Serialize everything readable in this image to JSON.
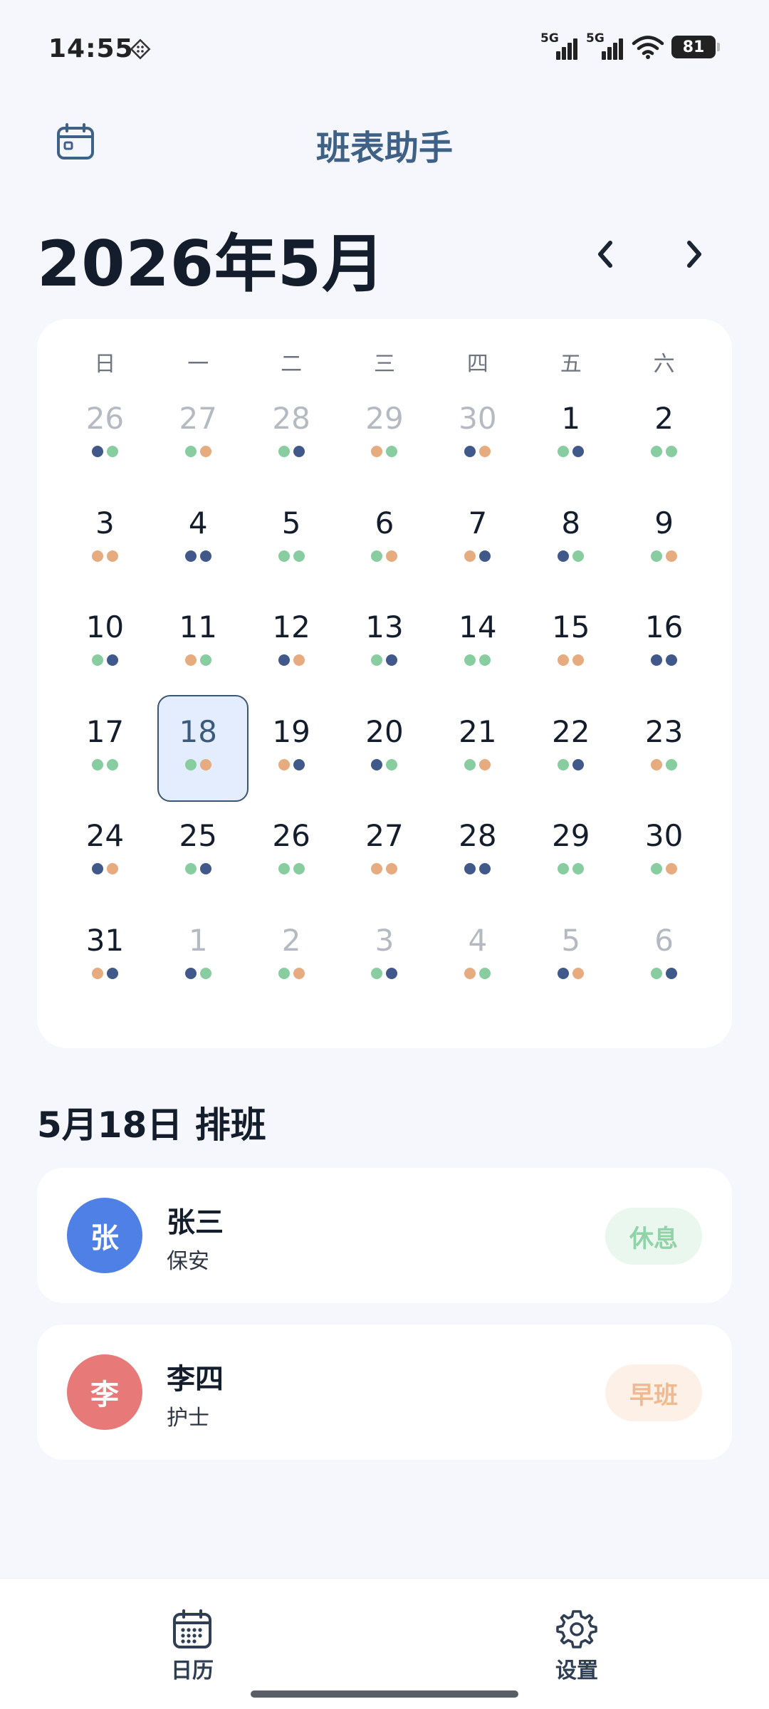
{
  "status_bar": {
    "time": "14:55",
    "network_1": "5G",
    "network_2": "5G",
    "battery": "81"
  },
  "header": {
    "title": "班表助手"
  },
  "calendar": {
    "month_title": "2026年5月",
    "weekdays": [
      "日",
      "一",
      "二",
      "三",
      "四",
      "五",
      "六"
    ],
    "selected_day": "18",
    "days": [
      {
        "n": "26",
        "other": true,
        "dots": [
          "blue",
          "green"
        ]
      },
      {
        "n": "27",
        "other": true,
        "dots": [
          "green",
          "orange"
        ]
      },
      {
        "n": "28",
        "other": true,
        "dots": [
          "green",
          "blue"
        ]
      },
      {
        "n": "29",
        "other": true,
        "dots": [
          "orange",
          "green"
        ]
      },
      {
        "n": "30",
        "other": true,
        "dots": [
          "blue",
          "orange"
        ]
      },
      {
        "n": "1",
        "other": false,
        "dots": [
          "green",
          "blue"
        ]
      },
      {
        "n": "2",
        "other": false,
        "dots": [
          "green",
          "green"
        ]
      },
      {
        "n": "3",
        "other": false,
        "dots": [
          "orange",
          "orange"
        ]
      },
      {
        "n": "4",
        "other": false,
        "dots": [
          "blue",
          "blue"
        ]
      },
      {
        "n": "5",
        "other": false,
        "dots": [
          "green",
          "green"
        ]
      },
      {
        "n": "6",
        "other": false,
        "dots": [
          "green",
          "orange"
        ]
      },
      {
        "n": "7",
        "other": false,
        "dots": [
          "orange",
          "blue"
        ]
      },
      {
        "n": "8",
        "other": false,
        "dots": [
          "blue",
          "green"
        ]
      },
      {
        "n": "9",
        "other": false,
        "dots": [
          "green",
          "orange"
        ]
      },
      {
        "n": "10",
        "other": false,
        "dots": [
          "green",
          "blue"
        ]
      },
      {
        "n": "11",
        "other": false,
        "dots": [
          "orange",
          "green"
        ]
      },
      {
        "n": "12",
        "other": false,
        "dots": [
          "blue",
          "orange"
        ]
      },
      {
        "n": "13",
        "other": false,
        "dots": [
          "green",
          "blue"
        ]
      },
      {
        "n": "14",
        "other": false,
        "dots": [
          "green",
          "green"
        ]
      },
      {
        "n": "15",
        "other": false,
        "dots": [
          "orange",
          "orange"
        ]
      },
      {
        "n": "16",
        "other": false,
        "dots": [
          "blue",
          "blue"
        ]
      },
      {
        "n": "17",
        "other": false,
        "dots": [
          "green",
          "green"
        ]
      },
      {
        "n": "18",
        "other": false,
        "dots": [
          "green",
          "orange"
        ]
      },
      {
        "n": "19",
        "other": false,
        "dots": [
          "orange",
          "blue"
        ]
      },
      {
        "n": "20",
        "other": false,
        "dots": [
          "blue",
          "green"
        ]
      },
      {
        "n": "21",
        "other": false,
        "dots": [
          "green",
          "orange"
        ]
      },
      {
        "n": "22",
        "other": false,
        "dots": [
          "green",
          "blue"
        ]
      },
      {
        "n": "23",
        "other": false,
        "dots": [
          "orange",
          "green"
        ]
      },
      {
        "n": "24",
        "other": false,
        "dots": [
          "blue",
          "orange"
        ]
      },
      {
        "n": "25",
        "other": false,
        "dots": [
          "green",
          "blue"
        ]
      },
      {
        "n": "26",
        "other": false,
        "dots": [
          "green",
          "green"
        ]
      },
      {
        "n": "27",
        "other": false,
        "dots": [
          "orange",
          "orange"
        ]
      },
      {
        "n": "28",
        "other": false,
        "dots": [
          "blue",
          "blue"
        ]
      },
      {
        "n": "29",
        "other": false,
        "dots": [
          "green",
          "green"
        ]
      },
      {
        "n": "30",
        "other": false,
        "dots": [
          "green",
          "orange"
        ]
      },
      {
        "n": "31",
        "other": false,
        "dots": [
          "orange",
          "blue"
        ]
      },
      {
        "n": "1",
        "other": true,
        "dots": [
          "blue",
          "green"
        ]
      },
      {
        "n": "2",
        "other": true,
        "dots": [
          "green",
          "orange"
        ]
      },
      {
        "n": "3",
        "other": true,
        "dots": [
          "green",
          "blue"
        ]
      },
      {
        "n": "4",
        "other": true,
        "dots": [
          "orange",
          "green"
        ]
      },
      {
        "n": "5",
        "other": true,
        "dots": [
          "blue",
          "orange"
        ]
      },
      {
        "n": "6",
        "other": true,
        "dots": [
          "green",
          "blue"
        ]
      }
    ]
  },
  "colors": {
    "blue": "#41598a",
    "green": "#88cda0",
    "orange": "#e6ab7e",
    "accent": "#3f6186",
    "avatar_zhang": "#4f80e6",
    "avatar_li": "#e77a78",
    "badge_rest_bg": "#eaf7ee",
    "badge_rest_text": "#8fd3a7",
    "badge_early_bg": "#fdf0e7",
    "badge_early_text": "#f0b992"
  },
  "schedule": {
    "title": "5月18日 排班",
    "entries": [
      {
        "avatar": "张",
        "name": "张三",
        "role": "保安",
        "shift": "休息"
      },
      {
        "avatar": "李",
        "name": "李四",
        "role": "护士",
        "shift": "早班"
      }
    ]
  },
  "bottom_nav": {
    "calendar_label": "日历",
    "settings_label": "设置"
  },
  "icons": {
    "header_left": "calendar-icon",
    "prev": "chevron-left-icon",
    "next": "chevron-right-icon",
    "nav_calendar": "calendar-grid-icon",
    "nav_settings": "gear-icon"
  }
}
